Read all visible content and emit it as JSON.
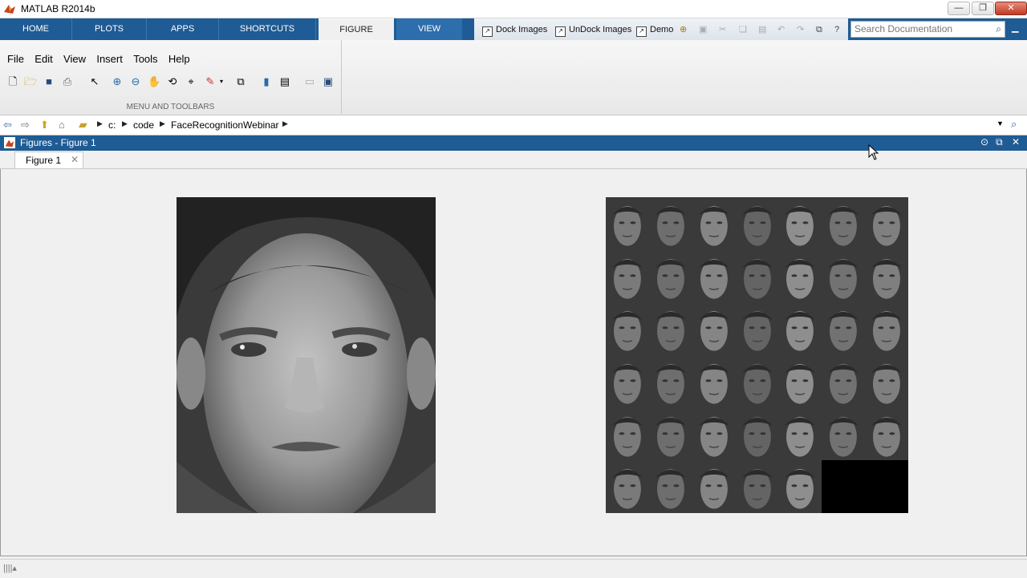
{
  "window": {
    "title": "MATLAB R2014b"
  },
  "ribbon": {
    "tabs": [
      "HOME",
      "PLOTS",
      "APPS",
      "SHORTCUTS",
      "FIGURE",
      "VIEW"
    ],
    "selected_tab": "FIGURE",
    "quick_access": [
      "Dock Images",
      "UnDock Images",
      "Demo"
    ],
    "search_placeholder": "Search Documentation"
  },
  "menu": [
    "File",
    "Edit",
    "View",
    "Insert",
    "Tools",
    "Help"
  ],
  "toolbar_section_label": "MENU AND TOOLBARS",
  "address": {
    "parts": [
      "c:",
      "code",
      "FaceRecognitionWebinar"
    ]
  },
  "figure_panel": {
    "title": "Figures - Figure 1",
    "tab": "Figure 1"
  },
  "face_grid": {
    "rows": 6,
    "cols": 7,
    "faces_shown": 40
  }
}
